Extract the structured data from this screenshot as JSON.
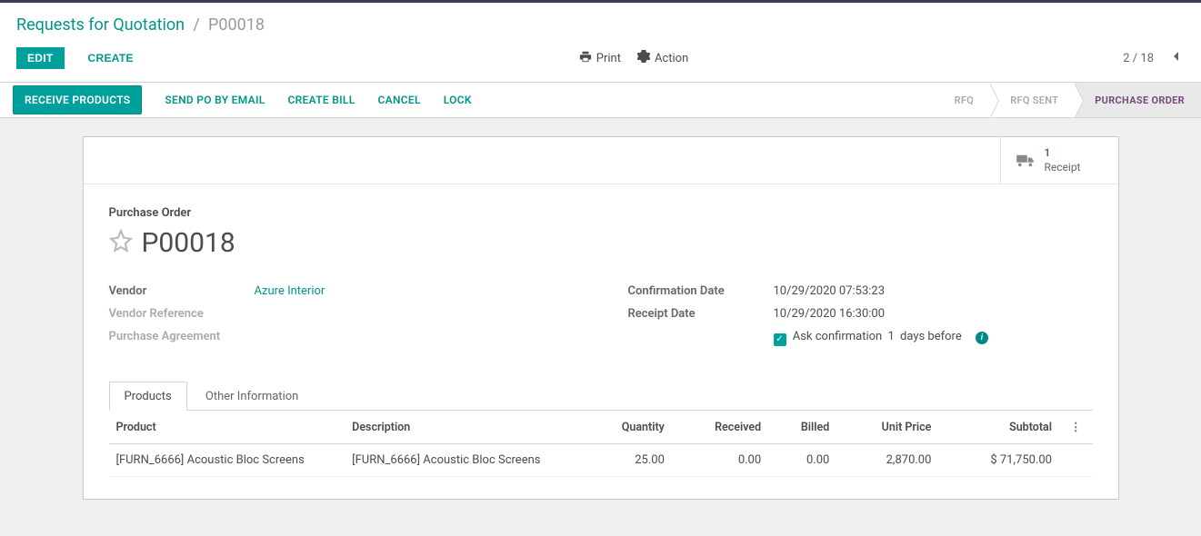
{
  "breadcrumb": {
    "parent": "Requests for Quotation",
    "current": "P00018"
  },
  "controls": {
    "edit": "EDIT",
    "create": "CREATE",
    "print": "Print",
    "action": "Action",
    "pager": "2 / 18"
  },
  "status_buttons": {
    "receive": "RECEIVE PRODUCTS",
    "sendpo": "SEND PO BY EMAIL",
    "createbill": "CREATE BILL",
    "cancel": "CANCEL",
    "lock": "LOCK"
  },
  "stages": {
    "rfq": "RFQ",
    "rfqsent": "RFQ SENT",
    "po": "PURCHASE ORDER"
  },
  "stat": {
    "count": "1",
    "label": "Receipt"
  },
  "header": {
    "label": "Purchase Order",
    "name": "P00018"
  },
  "fields": {
    "vendor_label": "Vendor",
    "vendor_value": "Azure Interior",
    "vendorref_label": "Vendor Reference",
    "pagreement_label": "Purchase Agreement",
    "confdate_label": "Confirmation Date",
    "confdate_value": "10/29/2020 07:53:23",
    "receiptdate_label": "Receipt Date",
    "receiptdate_value": "10/29/2020 16:30:00",
    "askconf_pre": "Ask confirmation",
    "askconf_days": "1",
    "askconf_post": "days before"
  },
  "tabs": {
    "products": "Products",
    "other": "Other Information"
  },
  "table": {
    "headers": {
      "product": "Product",
      "description": "Description",
      "quantity": "Quantity",
      "received": "Received",
      "billed": "Billed",
      "unitprice": "Unit Price",
      "subtotal": "Subtotal"
    },
    "rows": [
      {
        "product": "[FURN_6666] Acoustic Bloc Screens",
        "description": "[FURN_6666] Acoustic Bloc Screens",
        "quantity": "25.00",
        "received": "0.00",
        "billed": "0.00",
        "unitprice": "2,870.00",
        "subtotal": "$ 71,750.00"
      }
    ]
  }
}
